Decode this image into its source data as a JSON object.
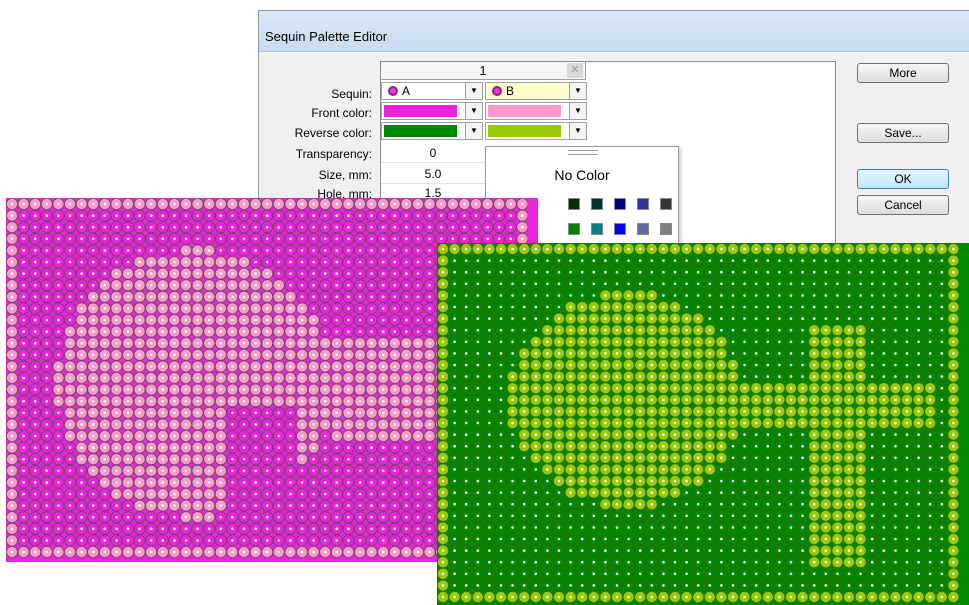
{
  "dialog": {
    "title": "Sequin Palette Editor",
    "column_header": "1",
    "close_glyph": "✕",
    "dropdown_glyph": "▼",
    "rows": {
      "sequin": "Sequin:",
      "front_color": "Front color:",
      "reverse_color": "Reverse color:",
      "transparency": "Transparency:",
      "size": "Size, mm:",
      "hole": "Hole, mm:"
    },
    "sequin_a": "A",
    "sequin_b": "B",
    "colors": {
      "a_front": "#ee22dd",
      "a_reverse": "#008800",
      "b_front": "#ff99cc",
      "b_reverse": "#99cc00"
    },
    "transparency_value": "0",
    "size_value": "5.0",
    "hole_value": "1.5",
    "buttons": {
      "more": "More",
      "save": "Save...",
      "ok": "OK",
      "cancel": "Cancel"
    }
  },
  "color_popup": {
    "no_color": "No Color",
    "palette_row1": [
      "#003300",
      "#003333",
      "#000080",
      "#333399",
      "#333333"
    ],
    "palette_row2": [
      "#008000",
      "#008080",
      "#0000ff",
      "#666699",
      "#808080"
    ]
  },
  "previews": {
    "pink_panel": {
      "base_color": "#ee22dd",
      "pattern_color": "#ff99cc",
      "outline": "#555555"
    },
    "green_panel": {
      "base_color": "#008800",
      "pattern_color": "#99cc00",
      "outline": "#2a6b00"
    }
  }
}
